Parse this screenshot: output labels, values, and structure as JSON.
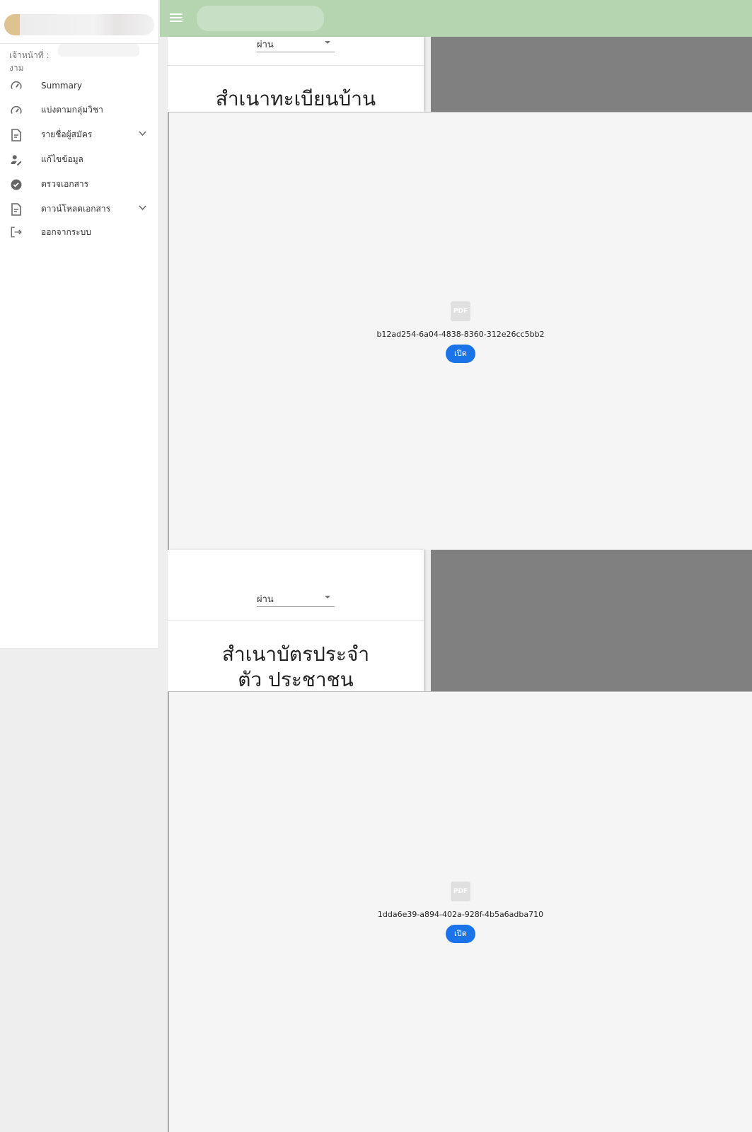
{
  "sidebar": {
    "staff_label": "เจ้าหน้าที่ :",
    "staff_sub": "งาม",
    "items": [
      {
        "label": "Summary",
        "icon": "speedometer-icon"
      },
      {
        "label": "แบ่งตามกลุ่มวิชา",
        "icon": "speedometer-icon"
      },
      {
        "label": "รายชื่อผู้สมัคร",
        "icon": "document-icon",
        "expandable": true
      },
      {
        "label": "แก้ไขข้อมูล",
        "icon": "user-edit-icon"
      },
      {
        "label": "ตรวจเอกสาร",
        "icon": "verified-badge-icon"
      },
      {
        "label": "ดาวน์โหลดเอกสาร",
        "icon": "document-icon",
        "expandable": true
      },
      {
        "label": "ออกจากระบบ",
        "icon": "logout-icon"
      }
    ]
  },
  "header": {
    "color": "#b5d5b0"
  },
  "documents": [
    {
      "status": "ผ่าน",
      "title": "สำเนาทะเบียนบ้าน",
      "pdf_label": "PDF",
      "filename": "b12ad254-6a04-4838-8360-312e26cc5bb2",
      "open_label": "เปิด"
    },
    {
      "status": "ผ่าน",
      "title": "สำเนาบัตรประจำตัว ประชาชน",
      "pdf_label": "PDF",
      "filename": "1dda6e39-a894-402a-928f-4b5a6adba710",
      "open_label": "เปิด"
    }
  ],
  "accent": "#1a73e8"
}
